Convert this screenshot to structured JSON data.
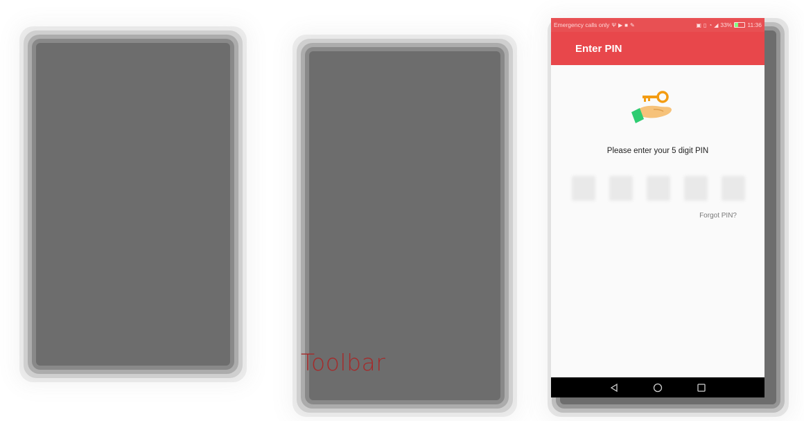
{
  "caption": {
    "text": "Toolbar",
    "color": "#a52a2a"
  },
  "phone": {
    "status_bar": {
      "left_text": "Emergency calls only",
      "left_icons": [
        "usb-icon",
        "play-icon",
        "video-icon",
        "wrench-icon"
      ],
      "right_icons": [
        "nfc-icon",
        "vibrate-icon",
        "wifi-icon",
        "signal-icon"
      ],
      "battery": "33%",
      "time": "11:36",
      "background": "#e8474b"
    },
    "app_bar": {
      "title": "Enter PIN",
      "background": "#e8474b"
    },
    "content": {
      "illustration": "key-in-hand-icon",
      "prompt": "Please enter your 5 digit PIN",
      "pin_digits": 5,
      "forgot_link": "Forgot PIN?"
    },
    "nav_bar": {
      "buttons": [
        "back-icon",
        "home-icon",
        "recents-icon"
      ]
    }
  }
}
